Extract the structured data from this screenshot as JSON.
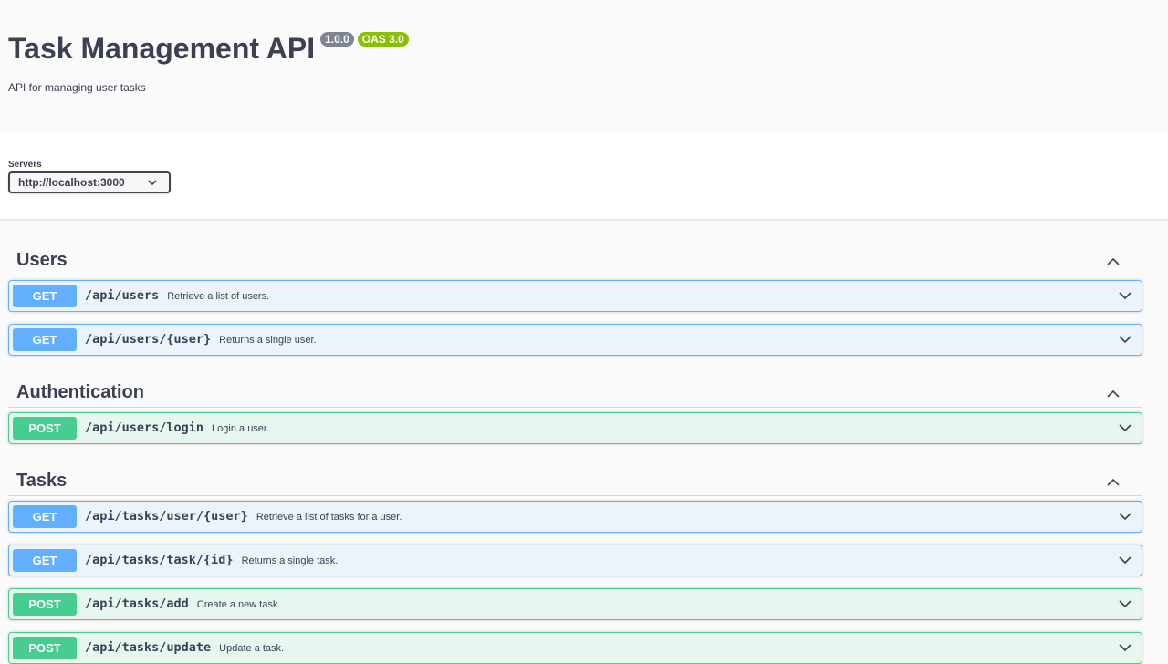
{
  "info": {
    "title": "Task Management API",
    "version_badge": "1.0.0",
    "oas_badge": "OAS 3.0",
    "description": "API for managing user tasks"
  },
  "servers": {
    "label": "Servers",
    "selected": "http://localhost:3000"
  },
  "sections": [
    {
      "title": "Users",
      "operations": [
        {
          "method": "GET",
          "path": "/api/users",
          "summary": "Retrieve a list of users."
        },
        {
          "method": "GET",
          "path": "/api/users/{user}",
          "summary": "Returns a single user."
        }
      ]
    },
    {
      "title": "Authentication",
      "operations": [
        {
          "method": "POST",
          "path": "/api/users/login",
          "summary": "Login a user."
        }
      ]
    },
    {
      "title": "Tasks",
      "operations": [
        {
          "method": "GET",
          "path": "/api/tasks/user/{user}",
          "summary": "Retrieve a list of tasks for a user."
        },
        {
          "method": "GET",
          "path": "/api/tasks/task/{id}",
          "summary": "Returns a single task."
        },
        {
          "method": "POST",
          "path": "/api/tasks/add",
          "summary": "Create a new task."
        },
        {
          "method": "POST",
          "path": "/api/tasks/update",
          "summary": "Update a task."
        }
      ]
    }
  ],
  "icons": {
    "section_toggle": "chevron-up-icon",
    "operation_toggle": "chevron-down-icon",
    "server_select": "chevron-down-icon"
  },
  "colors": {
    "get": "#61affe",
    "post": "#49cc90",
    "version_badge": "#7d8492",
    "oas_badge": "#89bf04"
  }
}
